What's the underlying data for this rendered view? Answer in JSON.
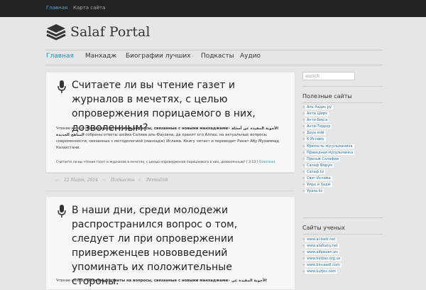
{
  "topbar": {
    "home": "Главная",
    "sitemap": "Карта сайта"
  },
  "site": {
    "name": "Salaf Portal"
  },
  "nav": {
    "items": [
      "Главная",
      "Манхадж",
      "Биографии лучших",
      "Подкасты",
      "Аудио"
    ]
  },
  "posts": [
    {
      "title": "Считаете ли вы чтение газет и журналов в мечетях, с целью опровержения порицаемого в них, дозволенным?",
      "body_intro": "Чтение книги «",
      "book_title": "Полезные ответы на вопросы, связанные с новыми манхаджами",
      "body_mid": "»",
      "arabic": "الأجوبة المفيدة عن أسئلة المناهج الجديدة",
      "body_rest": " собраны ответы шейха Салиха аль-Фаузана, да хранит его Аллах, на актуальные вопросы современности, связанные с методологией (манхадж) Ислама. Книгу читает и переводит Ринат Абу Мухаммад Казахстани.",
      "audio": "Считаете ли вы чтение газет и журналов в мечетях, с целью опровержения порицаемого в них, дозволенным?",
      "audio_duration": "[ 3:13 ]",
      "download": "Download",
      "date": "12 Март, 2014",
      "category": "Подкасты",
      "permalink": "Permalink"
    },
    {
      "title": "В наши дни, среди молодежи распространился вопрос о том, следует ли при опровержении приверженцев нововведений упоминать их положительные стороны.",
      "body_intro": "Чтение книги «",
      "book_title": "Полезные ответы на вопросы, связанные с новыми манхаджами",
      "body_mid": "»",
      "arabic": "الأجوبة المفيدة عن"
    }
  ],
  "sidebar": {
    "search_placeholder": "search",
    "useful_title": "Полезные сайты",
    "useful_links": [
      "Аль-Хадис.ру",
      "Анти Ширк",
      "Анти-Бид'а",
      "Анти-Террор",
      "Дауа.ком",
      "К Исламу",
      "Крепость мусульманина",
      "Праведная мусульманка",
      "Призыв Салафии",
      "Салаф Форум",
      "Салаф.kz",
      "Свет Ислама",
      "Умра и Хадж",
      "Ураза.kz"
    ],
    "scholars_title": "Сайты ученых",
    "scholar_links": [
      "www.al-badr.net",
      "www.alalbany.net",
      "www.alfawzan.ws",
      "www.binbaz.org.sa",
      "www.binsaadi.com",
      "www.burjes.com"
    ]
  },
  "colors": {
    "accent": "#1d8fb8",
    "topbar": "#222222",
    "background": "#e6e6e6"
  }
}
